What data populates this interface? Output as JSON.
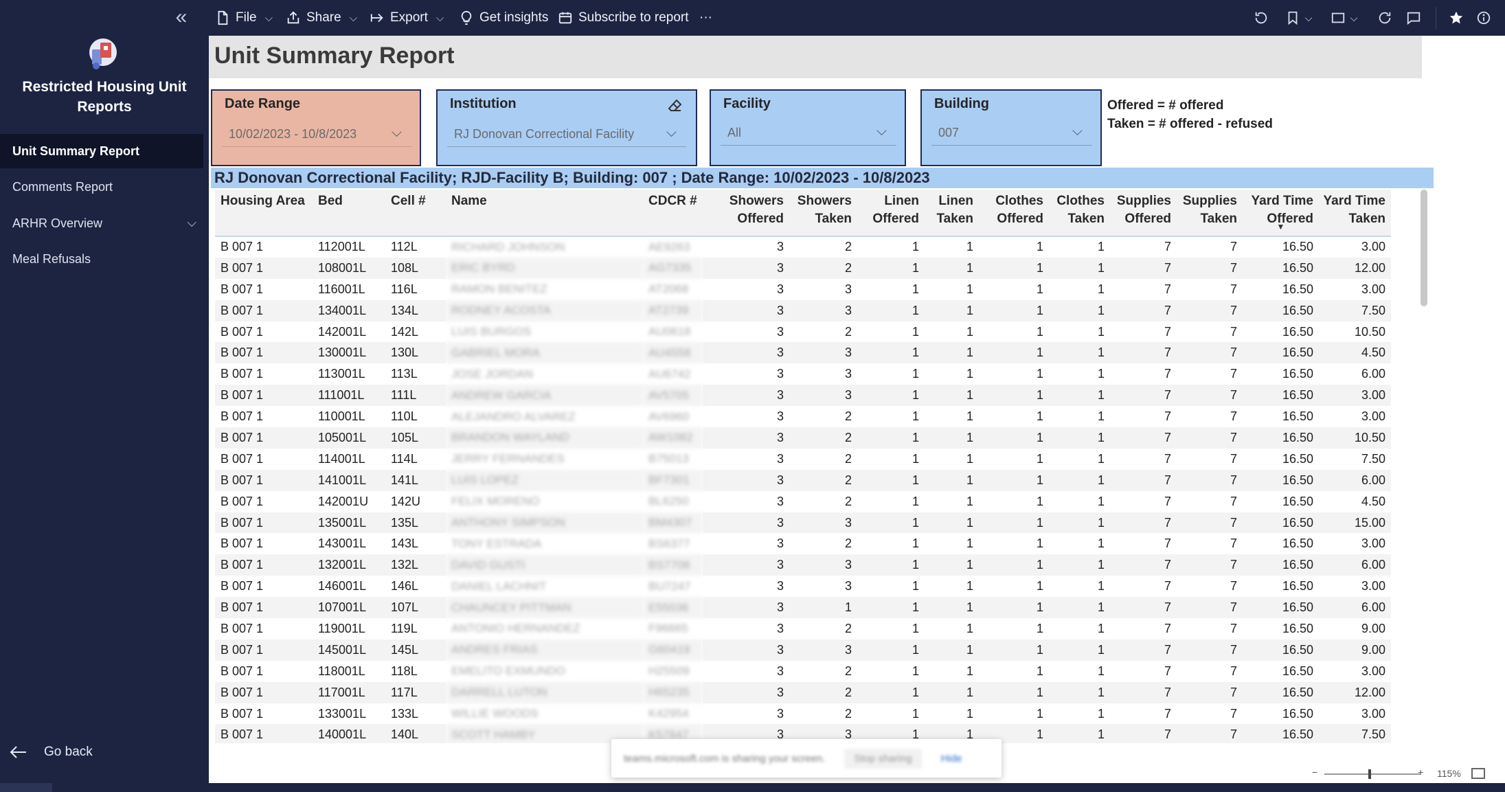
{
  "toolbar": {
    "file": "File",
    "share": "Share",
    "export": "Export",
    "get_insights": "Get insights",
    "subscribe": "Subscribe to report",
    "more": "···"
  },
  "sidebar": {
    "app_title": "Restricted Housing Unit Reports",
    "items": [
      {
        "label": "Unit Summary Report",
        "active": true
      },
      {
        "label": "Comments Report"
      },
      {
        "label": "ARHR Overview",
        "expandable": true
      },
      {
        "label": "Meal Refusals"
      }
    ],
    "go_back": "Go back"
  },
  "report": {
    "title": "Unit Summary Report",
    "slicers": {
      "date_range": {
        "title": "Date Range",
        "value": "10/02/2023 - 10/8/2023"
      },
      "institution": {
        "title": "Institution",
        "value": "RJ Donovan Correctional Facility"
      },
      "facility": {
        "title": "Facility",
        "value": "All"
      },
      "building": {
        "title": "Building",
        "value": "007"
      }
    },
    "legend_note": {
      "offered": "Offered = # offered",
      "taken": "Taken = # offered - refused"
    },
    "banner": "RJ Donovan Correctional Facility; RJD-Facility B; Building: 007 ; Date Range: 10/02/2023 - 10/8/2023"
  },
  "table": {
    "columns": [
      "Housing Area",
      "Bed",
      "Cell #",
      "Name",
      "CDCR #",
      "Showers Offered",
      "Showers Taken",
      "Linen Offered",
      "Linen Taken",
      "Clothes Offered",
      "Clothes Taken",
      "Supplies Offered",
      "Supplies Taken",
      "Yard Time Offered",
      "Yard Time Taken"
    ],
    "rows": [
      [
        "B 007 1",
        "112001L",
        "112L",
        "RICHARD JOHNSON",
        "AE9263",
        "3",
        "2",
        "1",
        "1",
        "1",
        "1",
        "7",
        "7",
        "16.50",
        "3.00"
      ],
      [
        "B 007 1",
        "108001L",
        "108L",
        "ERIC BYRD",
        "AG7335",
        "3",
        "2",
        "1",
        "1",
        "1",
        "1",
        "7",
        "7",
        "16.50",
        "12.00"
      ],
      [
        "B 007 1",
        "116001L",
        "116L",
        "RAMON BENITEZ",
        "AT2068",
        "3",
        "3",
        "1",
        "1",
        "1",
        "1",
        "7",
        "7",
        "16.50",
        "3.00"
      ],
      [
        "B 007 1",
        "134001L",
        "134L",
        "RODNEY ACOSTA",
        "AT2739",
        "3",
        "3",
        "1",
        "1",
        "1",
        "1",
        "7",
        "7",
        "16.50",
        "7.50"
      ],
      [
        "B 007 1",
        "142001L",
        "142L",
        "LUIS BURGOS",
        "AU0618",
        "3",
        "2",
        "1",
        "1",
        "1",
        "1",
        "7",
        "7",
        "16.50",
        "10.50"
      ],
      [
        "B 007 1",
        "130001L",
        "130L",
        "GABRIEL MORA",
        "AU4558",
        "3",
        "3",
        "1",
        "1",
        "1",
        "1",
        "7",
        "7",
        "16.50",
        "4.50"
      ],
      [
        "B 007 1",
        "113001L",
        "113L",
        "JOSE JORDAN",
        "AU6742",
        "3",
        "3",
        "1",
        "1",
        "1",
        "1",
        "7",
        "7",
        "16.50",
        "6.00"
      ],
      [
        "B 007 1",
        "111001L",
        "111L",
        "ANDREW GARCIA",
        "AV5705",
        "3",
        "3",
        "1",
        "1",
        "1",
        "1",
        "7",
        "7",
        "16.50",
        "3.00"
      ],
      [
        "B 007 1",
        "110001L",
        "110L",
        "ALEJANDRO ALVAREZ",
        "AV6960",
        "3",
        "2",
        "1",
        "1",
        "1",
        "1",
        "7",
        "7",
        "16.50",
        "3.00"
      ],
      [
        "B 007 1",
        "105001L",
        "105L",
        "BRANDON WAYLAND",
        "AW1082",
        "3",
        "2",
        "1",
        "1",
        "1",
        "1",
        "7",
        "7",
        "16.50",
        "10.50"
      ],
      [
        "B 007 1",
        "114001L",
        "114L",
        "JERRY FERNANDES",
        "B75013",
        "3",
        "2",
        "1",
        "1",
        "1",
        "1",
        "7",
        "7",
        "16.50",
        "7.50"
      ],
      [
        "B 007 1",
        "141001L",
        "141L",
        "LUIS LOPEZ",
        "BF7301",
        "3",
        "2",
        "1",
        "1",
        "1",
        "1",
        "7",
        "7",
        "16.50",
        "6.00"
      ],
      [
        "B 007 1",
        "142001U",
        "142U",
        "FELIX MORENO",
        "BL6250",
        "3",
        "2",
        "1",
        "1",
        "1",
        "1",
        "7",
        "7",
        "16.50",
        "4.50"
      ],
      [
        "B 007 1",
        "135001L",
        "135L",
        "ANTHONY SIMPSON",
        "BM4307",
        "3",
        "3",
        "1",
        "1",
        "1",
        "1",
        "7",
        "7",
        "16.50",
        "15.00"
      ],
      [
        "B 007 1",
        "143001L",
        "143L",
        "TONY ESTRADA",
        "BS6377",
        "3",
        "2",
        "1",
        "1",
        "1",
        "1",
        "7",
        "7",
        "16.50",
        "3.00"
      ],
      [
        "B 007 1",
        "132001L",
        "132L",
        "DAVID GUSTI",
        "BS7708",
        "3",
        "3",
        "1",
        "1",
        "1",
        "1",
        "7",
        "7",
        "16.50",
        "6.00"
      ],
      [
        "B 007 1",
        "146001L",
        "146L",
        "DANIEL LACHNIT",
        "BU7247",
        "3",
        "3",
        "1",
        "1",
        "1",
        "1",
        "7",
        "7",
        "16.50",
        "3.00"
      ],
      [
        "B 007 1",
        "107001L",
        "107L",
        "CHAUNCEY PITTMAN",
        "E55036",
        "3",
        "1",
        "1",
        "1",
        "1",
        "1",
        "7",
        "7",
        "16.50",
        "6.00"
      ],
      [
        "B 007 1",
        "119001L",
        "119L",
        "ANTONIO HERNANDEZ",
        "F96665",
        "3",
        "2",
        "1",
        "1",
        "1",
        "1",
        "7",
        "7",
        "16.50",
        "9.00"
      ],
      [
        "B 007 1",
        "145001L",
        "145L",
        "ANDRES FRIAS",
        "G60419",
        "3",
        "3",
        "1",
        "1",
        "1",
        "1",
        "7",
        "7",
        "16.50",
        "9.00"
      ],
      [
        "B 007 1",
        "118001L",
        "118L",
        "EMELITO EXMUNDO",
        "H25509",
        "3",
        "2",
        "1",
        "1",
        "1",
        "1",
        "7",
        "7",
        "16.50",
        "3.00"
      ],
      [
        "B 007 1",
        "117001L",
        "117L",
        "DARRELL LUTON",
        "H65235",
        "3",
        "2",
        "1",
        "1",
        "1",
        "1",
        "7",
        "7",
        "16.50",
        "12.00"
      ],
      [
        "B 007 1",
        "133001L",
        "133L",
        "WILLIE WOODS",
        "K42954",
        "3",
        "2",
        "1",
        "1",
        "1",
        "1",
        "7",
        "7",
        "16.50",
        "3.00"
      ],
      [
        "B 007 1",
        "140001L",
        "140L",
        "SCOTT HAMBY",
        "K57847",
        "3",
        "3",
        "1",
        "1",
        "1",
        "1",
        "7",
        "7",
        "16.50",
        "7.50"
      ]
    ]
  },
  "toast": {
    "text": "teams.microsoft.com is sharing your screen.",
    "stop": "Stop sharing",
    "hide": "Hide"
  },
  "zoom": {
    "value": "115%"
  },
  "colors": {
    "chrome": "#1d2442",
    "slicer_date": "#e9b6a4",
    "slicer_blue": "#aacdf4"
  },
  "icons": [
    "collapse-icon",
    "file-icon",
    "share-icon",
    "export-icon",
    "lightbulb-icon",
    "subscribe-icon",
    "reset-icon",
    "bookmark-icon",
    "view-icon",
    "refresh-icon",
    "comment-icon",
    "star-icon",
    "info-icon",
    "eraser-icon",
    "back-arrow-icon",
    "app-logo"
  ]
}
